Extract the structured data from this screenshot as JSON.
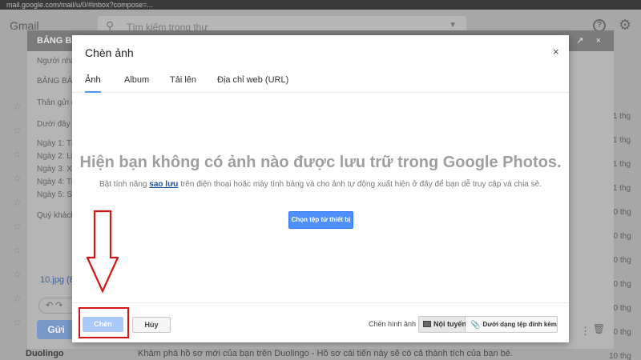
{
  "browser": {
    "url_text": "mail.google.com/mail/u/0/#inbox?compose=..."
  },
  "gmail": {
    "logo": "Gmail",
    "search_placeholder": "Tìm kiếm trong thư",
    "dates": [
      "11 thg",
      "11 thg",
      "11 thg",
      "11 thg",
      "10 thg",
      "10 thg",
      "10 thg",
      "10 thg",
      "10 thg",
      "10 thg",
      "10 thg"
    ],
    "bottom_row": {
      "sender": "Duolingo",
      "subject": "Khám phá hồ sơ mới của bạn trên Duolingo - Hồ sơ cái tiến này sẽ có cả thành tích của bạn bè."
    }
  },
  "compose": {
    "title": "BẢNG BÁO",
    "controls": "_ ↗ ×",
    "lines": [
      "Người nhận",
      "BẢNG BÁO",
      "Thân gửi qu",
      "Dưới đây là",
      "Ngày 1: Tổ",
      "Ngày 2: Liê",
      "Ngày 3: Xe",
      "Ngày 4: Trả",
      "Ngày 5: Sử",
      "Quý khách"
    ],
    "attachment": "10.jpg (8",
    "send_label": "Gửi"
  },
  "modal": {
    "title": "Chèn ảnh",
    "tabs": [
      "Ảnh",
      "Album",
      "Tải lên",
      "Địa chỉ web (URL)"
    ],
    "active_tab": 0,
    "empty_message": "Hiện bạn không có ảnh nào được lưu trữ trong Google Photos.",
    "empty_sub_before": "Bật tính năng ",
    "empty_sub_link": "sao lưu",
    "empty_sub_after": " trên điện thoại hoặc máy tính bảng và cho ảnh tự động xuất hiện ở đây để bạn dễ truy cập và chia sẻ.",
    "choose_file_label": "Chọn tệp từ thiết bị",
    "insert_label": "Chèn",
    "cancel_label": "Hủy",
    "insert_mode_label": "Chèn hình ảnh",
    "mode_inline_label": "Nội tuyến",
    "mode_attach_label": "Dưới dạng tệp đính kèm"
  },
  "colors": {
    "accent": "#4d90fe",
    "annotation": "#d41515"
  }
}
